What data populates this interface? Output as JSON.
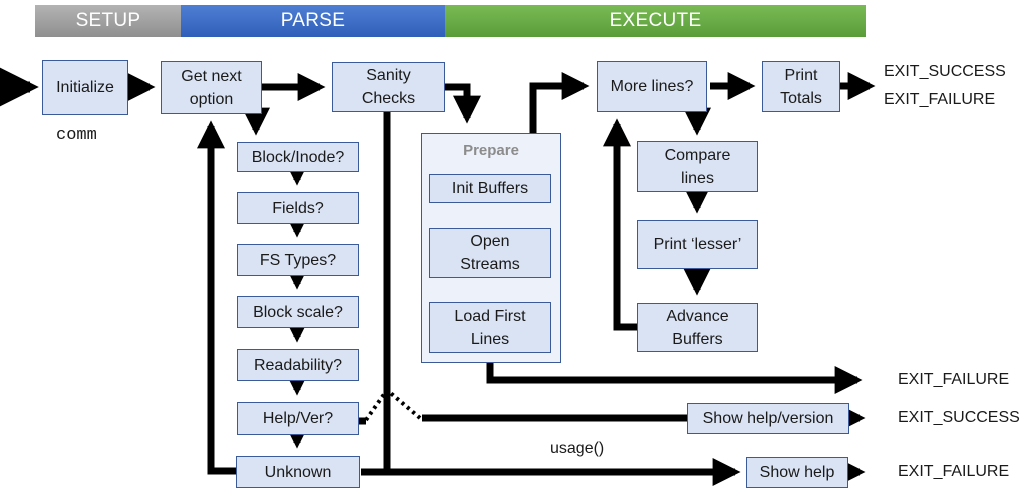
{
  "phases": {
    "setup": "SETUP",
    "parse": "PARSE",
    "execute": "EXECUTE"
  },
  "colors": {
    "setup": "#9e9e9e",
    "parse": "#3a6cc6",
    "execute": "#68ac45",
    "box_fill": "#dae3f3",
    "box_border": "#3b5a9a",
    "container_fill": "#edf1fa"
  },
  "nodes": {
    "initialize": "Initialize",
    "get_next_option": "Get next\noption",
    "sanity_checks": "Sanity\nChecks",
    "block_inode": "Block/Inode?",
    "fields": "Fields?",
    "fs_types": "FS Types?",
    "block_scale": "Block scale?",
    "readability": "Readability?",
    "help_ver": "Help/Ver?",
    "unknown": "Unknown",
    "prepare": {
      "title": "Prepare",
      "init_buffers": "Init Buffers",
      "open_streams": "Open\nStreams",
      "load_first_lines": "Load First\nLines"
    },
    "more_lines": "More lines?",
    "print_totals": "Print\nTotals",
    "compare_lines": "Compare\nlines",
    "print_lesser": "Print ‘lesser’",
    "advance_buffers": "Advance\nBuffers",
    "show_help_version": "Show help/version",
    "show_help": "Show help"
  },
  "labels": {
    "comm": "comm",
    "usage": "usage()",
    "totals_exit_success": "EXIT_SUCCESS",
    "totals_exit_failure": "EXIT_FAILURE",
    "prepare_exit_failure": "EXIT_FAILURE",
    "help_exit_success": "EXIT_SUCCESS",
    "unknown_exit_failure": "EXIT_FAILURE"
  }
}
